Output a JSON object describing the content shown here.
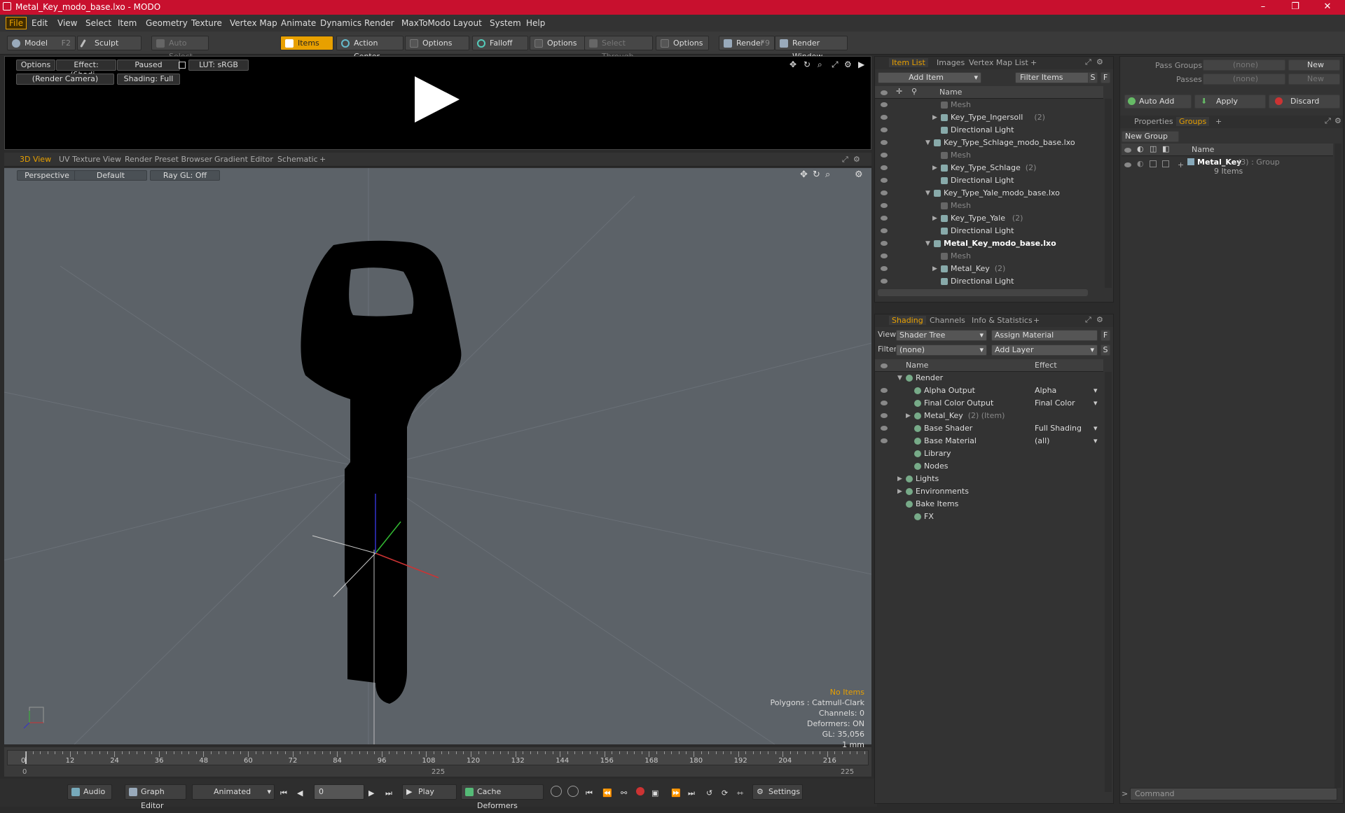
{
  "titlebar": {
    "title": "Metal_Key_modo_base.lxo - MODO"
  },
  "menu": [
    "File",
    "Edit",
    "View",
    "Select",
    "Item",
    "Geometry",
    "Texture",
    "Vertex Map",
    "Animate",
    "Dynamics",
    "Render",
    "MaxToModo",
    "Layout",
    "System",
    "Help"
  ],
  "toolbar": {
    "model": "Model",
    "model_key": "F2",
    "sculpt": "Sculpt",
    "auto_select": "Auto Select",
    "items": "Items",
    "action_center": "Action Center",
    "options1": "Options",
    "falloff": "Falloff",
    "options2": "Options",
    "select_through": "Select Through",
    "options3": "Options",
    "render": "Render",
    "render_key": "F9",
    "render_window": "Render Window"
  },
  "preview": {
    "options": "Options",
    "effect": "Effect: (Shadi...",
    "paused": "Paused",
    "lut": "LUT: sRGB",
    "camera": "(Render Camera)",
    "shading": "Shading: Full"
  },
  "viewport_tabs": [
    "3D View",
    "UV Texture View",
    "Render Preset Browser",
    "Gradient Editor",
    "Schematic"
  ],
  "viewport": {
    "perspective": "Perspective",
    "default": "Default",
    "raygl": "Ray GL: Off",
    "stats": [
      "No Items",
      "Polygons : Catmull-Clark",
      "Channels: 0",
      "Deformers: ON",
      "GL: 35,056",
      "1 mm"
    ]
  },
  "timeline": {
    "ticks": [
      "0",
      "12",
      "24",
      "36",
      "48",
      "60",
      "72",
      "84",
      "96",
      "108",
      "120",
      "132",
      "144",
      "156",
      "168",
      "180",
      "192",
      "204",
      "216"
    ],
    "lower": [
      "0",
      "225",
      "225"
    ]
  },
  "bottombar": {
    "audio": "Audio",
    "graph_editor": "Graph Editor",
    "animated": "Animated",
    "frame": "0",
    "play": "Play",
    "cache": "Cache Deformers",
    "settings": "Settings"
  },
  "itemlist": {
    "tabs": [
      "Item List",
      "Images",
      "Vertex Map List"
    ],
    "add_item": "Add Item",
    "filter_items": "Filter Items",
    "s": "S",
    "f": "F",
    "col_name": "Name",
    "rows": [
      {
        "label": "Mesh",
        "count": "",
        "indent": 2,
        "dim": true,
        "bold": false,
        "arrow": ""
      },
      {
        "label": "Key_Type_Ingersoll",
        "count": "(2)",
        "indent": 2,
        "dim": false,
        "bold": false,
        "arrow": "▶"
      },
      {
        "label": "Directional Light",
        "count": "",
        "indent": 2,
        "dim": false,
        "bold": false,
        "arrow": ""
      },
      {
        "label": "Key_Type_Schlage_modo_base.lxo",
        "count": "",
        "indent": 1,
        "dim": false,
        "bold": false,
        "arrow": "▼"
      },
      {
        "label": "Mesh",
        "count": "",
        "indent": 2,
        "dim": true,
        "bold": false,
        "arrow": ""
      },
      {
        "label": "Key_Type_Schlage",
        "count": "(2)",
        "indent": 2,
        "dim": false,
        "bold": false,
        "arrow": "▶"
      },
      {
        "label": "Directional Light",
        "count": "",
        "indent": 2,
        "dim": false,
        "bold": false,
        "arrow": ""
      },
      {
        "label": "Key_Type_Yale_modo_base.lxo",
        "count": "",
        "indent": 1,
        "dim": false,
        "bold": false,
        "arrow": "▼"
      },
      {
        "label": "Mesh",
        "count": "",
        "indent": 2,
        "dim": true,
        "bold": false,
        "arrow": ""
      },
      {
        "label": "Key_Type_Yale",
        "count": "(2)",
        "indent": 2,
        "dim": false,
        "bold": false,
        "arrow": "▶"
      },
      {
        "label": "Directional Light",
        "count": "",
        "indent": 2,
        "dim": false,
        "bold": false,
        "arrow": ""
      },
      {
        "label": "Metal_Key_modo_base.lxo",
        "count": "",
        "indent": 1,
        "dim": false,
        "bold": true,
        "arrow": "▼"
      },
      {
        "label": "Mesh",
        "count": "",
        "indent": 2,
        "dim": true,
        "bold": false,
        "arrow": ""
      },
      {
        "label": "Metal_Key",
        "count": "(2)",
        "indent": 2,
        "dim": false,
        "bold": false,
        "arrow": "▶"
      },
      {
        "label": "Directional Light",
        "count": "",
        "indent": 2,
        "dim": false,
        "bold": false,
        "arrow": ""
      }
    ]
  },
  "shading": {
    "tabs": [
      "Shading",
      "Channels",
      "Info & Statistics"
    ],
    "view_label": "View",
    "view_value": "Shader Tree",
    "assign_material": "Assign Material",
    "filter_label": "Filter",
    "filter_value": "(none)",
    "add_layer": "Add Layer",
    "col_name": "Name",
    "col_effect": "Effect",
    "rows": [
      {
        "label": "Render",
        "extra": "",
        "effect": "",
        "indent": 0,
        "arrow": "▼",
        "eye": false
      },
      {
        "label": "Alpha Output",
        "extra": "",
        "effect": "Alpha",
        "indent": 1,
        "arrow": "",
        "eye": true
      },
      {
        "label": "Final Color Output",
        "extra": "",
        "effect": "Final Color",
        "indent": 1,
        "arrow": "",
        "eye": true
      },
      {
        "label": "Metal_Key",
        "extra": "(2) (Item)",
        "effect": "",
        "indent": 1,
        "arrow": "▶",
        "eye": true
      },
      {
        "label": "Base Shader",
        "extra": "",
        "effect": "Full Shading",
        "indent": 1,
        "arrow": "",
        "eye": true
      },
      {
        "label": "Base Material",
        "extra": "",
        "effect": "(all)",
        "indent": 1,
        "arrow": "",
        "eye": true
      },
      {
        "label": "Library",
        "extra": "",
        "effect": "",
        "indent": 1,
        "arrow": "",
        "eye": false
      },
      {
        "label": "Nodes",
        "extra": "",
        "effect": "",
        "indent": 1,
        "arrow": "",
        "eye": false
      },
      {
        "label": "Lights",
        "extra": "",
        "effect": "",
        "indent": 0,
        "arrow": "▶",
        "eye": false
      },
      {
        "label": "Environments",
        "extra": "",
        "effect": "",
        "indent": 0,
        "arrow": "▶",
        "eye": false
      },
      {
        "label": "Bake Items",
        "extra": "",
        "effect": "",
        "indent": 0,
        "arrow": "",
        "eye": false
      },
      {
        "label": "FX",
        "extra": "",
        "effect": "",
        "indent": 1,
        "arrow": "",
        "eye": false
      }
    ]
  },
  "passgroups": {
    "pass_groups": "Pass Groups",
    "passes": "Passes",
    "none1": "(none)",
    "none2": "(none)",
    "new1": "New",
    "new2": "New",
    "auto_add": "Auto Add",
    "apply": "Apply",
    "discard": "Discard"
  },
  "groups": {
    "tabs": [
      "Properties",
      "Groups"
    ],
    "new_group": "New Group",
    "col_name": "Name",
    "item_name": "Metal_Key",
    "item_count": "(3) : Group",
    "item_sub": "9 Items"
  },
  "command": {
    "placeholder": "Command"
  }
}
